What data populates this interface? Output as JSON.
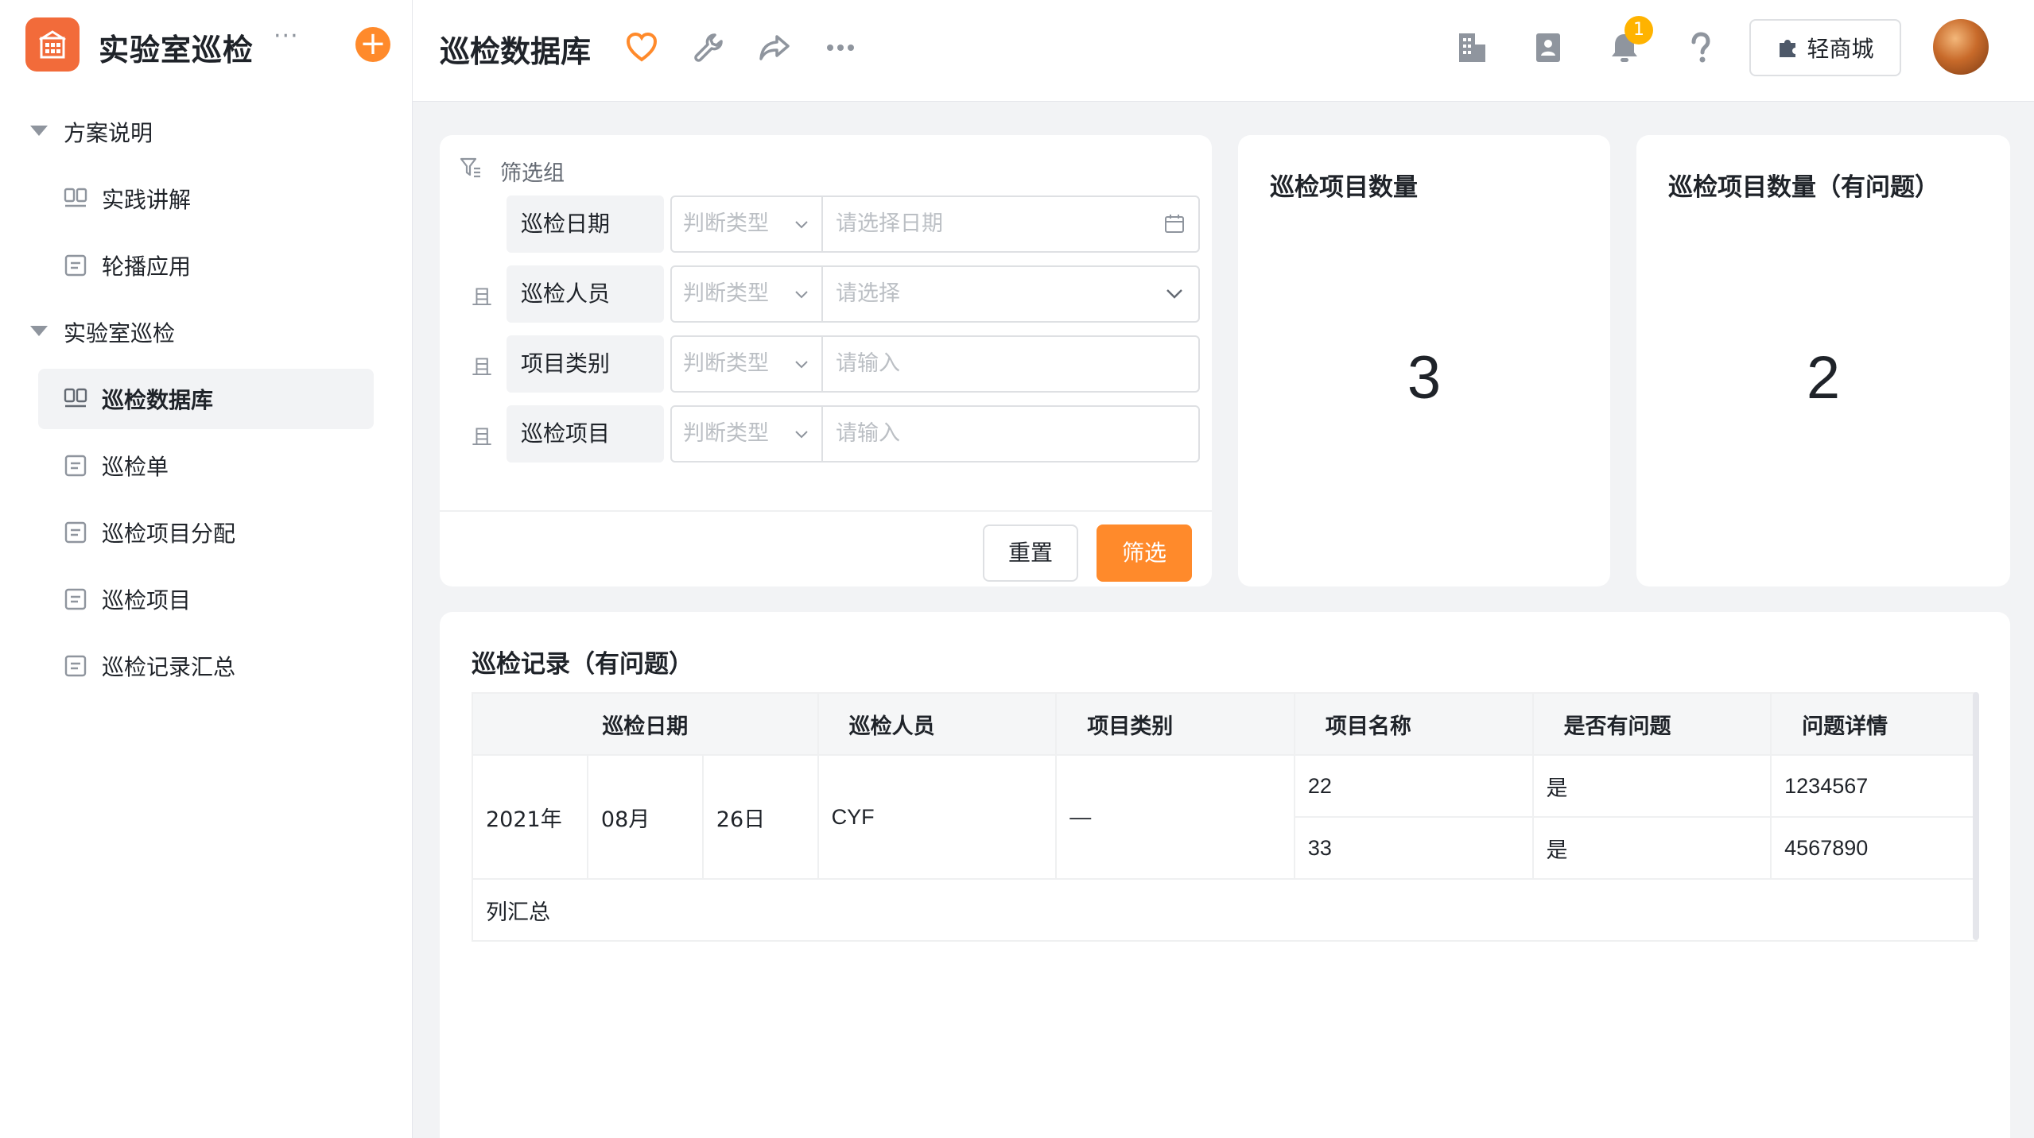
{
  "app": {
    "title": "实验室巡检",
    "more": "···",
    "add": "+",
    "brand_color": "#f26b3a",
    "accent_color": "#ff8a2b"
  },
  "sidebar": {
    "groups": [
      {
        "label": "方案说明",
        "items": [
          {
            "label": "实践讲解",
            "icon": "dashboard-icon"
          },
          {
            "label": "轮播应用",
            "icon": "form-icon"
          }
        ]
      },
      {
        "label": "实验室巡检",
        "items": [
          {
            "label": "巡检数据库",
            "icon": "dashboard-icon",
            "active": true
          },
          {
            "label": "巡检单",
            "icon": "form-icon"
          },
          {
            "label": "巡检项目分配",
            "icon": "form-icon"
          },
          {
            "label": "巡检项目",
            "icon": "form-icon"
          },
          {
            "label": "巡检记录汇总",
            "icon": "form-icon"
          }
        ]
      }
    ]
  },
  "header": {
    "title": "巡检数据库",
    "notification_count": "1",
    "mall_label": "轻商城",
    "icons": [
      "heart-icon",
      "wrench-icon",
      "share-icon",
      "more-icon",
      "building-icon",
      "contacts-icon",
      "bell-icon",
      "help-icon",
      "puzzle-icon"
    ]
  },
  "filter": {
    "title": "筛选组",
    "rows": [
      {
        "conj": "",
        "field": "巡检日期",
        "type_placeholder": "判断类型",
        "value_placeholder": "请选择日期",
        "control": "date"
      },
      {
        "conj": "且",
        "field": "巡检人员",
        "type_placeholder": "判断类型",
        "value_placeholder": "请选择",
        "control": "select"
      },
      {
        "conj": "且",
        "field": "项目类别",
        "type_placeholder": "判断类型",
        "value_placeholder": "请输入",
        "control": "text"
      },
      {
        "conj": "且",
        "field": "巡检项目",
        "type_placeholder": "判断类型",
        "value_placeholder": "请输入",
        "control": "text"
      }
    ],
    "reset_label": "重置",
    "submit_label": "筛选"
  },
  "stats": [
    {
      "title": "巡检项目数量",
      "value": "3"
    },
    {
      "title": "巡检项目数量（有问题）",
      "value": "2"
    }
  ],
  "records": {
    "title": "巡检记录（有问题）",
    "headers": [
      "巡检日期",
      "巡检人员",
      "项目类别",
      "项目名称",
      "是否有问题",
      "问题详情"
    ],
    "group": {
      "year": "2021年",
      "month": "08月",
      "day": "26日",
      "person": "CYF",
      "category": "—"
    },
    "rows": [
      {
        "name": "22",
        "has_issue": "是",
        "detail": "1234567"
      },
      {
        "name": "33",
        "has_issue": "是",
        "detail": "4567890"
      }
    ],
    "summary_label": "列汇总"
  }
}
